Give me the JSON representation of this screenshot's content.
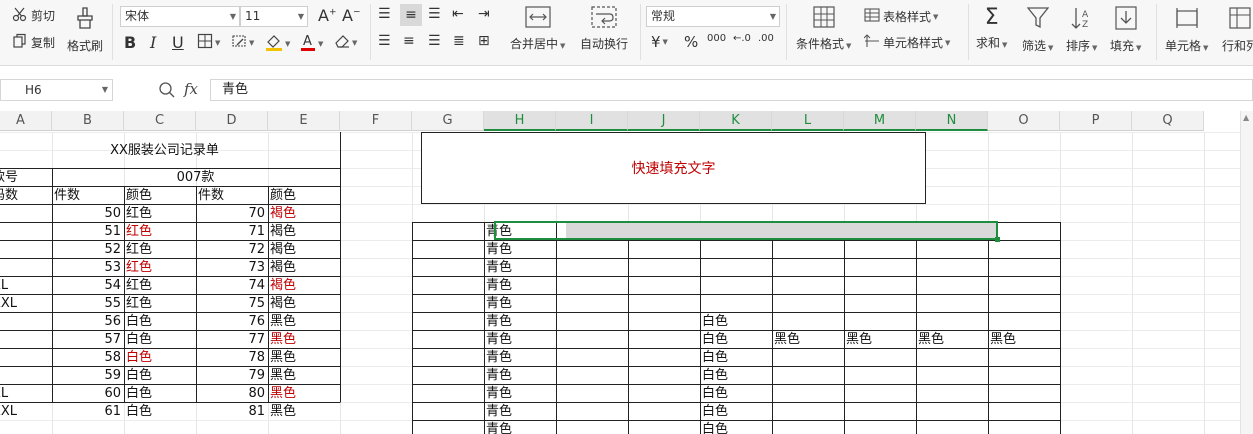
{
  "ribbon": {
    "cut": "剪切",
    "copy": "复制",
    "format_painter": "格式刷",
    "font_name": "宋体",
    "font_size": "11",
    "merge_center": "合并居中",
    "wrap_text": "自动换行",
    "number_format": "常规",
    "conditional_format": "条件格式",
    "table_style": "表格样式",
    "cell_style": "单元格样式",
    "sum": "求和",
    "filter": "筛选",
    "sort": "排序",
    "fill": "填充",
    "cell": "单元格",
    "row_col": "行和列",
    "currency_symbol": "¥",
    "percent_symbol": "%",
    "thousands_symbol": "000"
  },
  "formula_bar": {
    "name_box": "H6",
    "fx": "fx",
    "content": "青色"
  },
  "columns": [
    "A",
    "B",
    "C",
    "D",
    "E",
    "F",
    "G",
    "H",
    "I",
    "J",
    "K",
    "L",
    "M",
    "N",
    "O",
    "P",
    "Q"
  ],
  "selected_column_range": [
    "H",
    "I",
    "J",
    "K",
    "L",
    "M",
    "N"
  ],
  "table1": {
    "title": "XX服装公司记录单",
    "style_label": "款号",
    "style_value": "007款",
    "headers": [
      "码数",
      "件数",
      "颜色",
      "件数",
      "颜色"
    ],
    "rows": [
      {
        "size": "",
        "q1": "50",
        "c1": "红色",
        "q2": "70",
        "c2": "褐色",
        "c1_red": false,
        "c2_red": true
      },
      {
        "size": "",
        "q1": "51",
        "c1": "红色",
        "q2": "71",
        "c2": "褐色",
        "c1_red": true,
        "c2_red": false
      },
      {
        "size": "",
        "q1": "52",
        "c1": "红色",
        "q2": "72",
        "c2": "褐色",
        "c1_red": false,
        "c2_red": false
      },
      {
        "size": "L",
        "q1": "53",
        "c1": "红色",
        "q2": "73",
        "c2": "褐色",
        "c1_red": true,
        "c2_red": false
      },
      {
        "size": "XL",
        "q1": "54",
        "c1": "红色",
        "q2": "74",
        "c2": "褐色",
        "c1_red": false,
        "c2_red": true
      },
      {
        "size": "XXL",
        "q1": "55",
        "c1": "红色",
        "q2": "75",
        "c2": "褐色",
        "c1_red": false,
        "c2_red": false
      },
      {
        "size": "",
        "q1": "56",
        "c1": "白色",
        "q2": "76",
        "c2": "黑色",
        "c1_red": false,
        "c2_red": false
      },
      {
        "size": "",
        "q1": "57",
        "c1": "白色",
        "q2": "77",
        "c2": "黑色",
        "c1_red": false,
        "c2_red": true
      },
      {
        "size": "",
        "q1": "58",
        "c1": "白色",
        "q2": "78",
        "c2": "黑色",
        "c1_red": true,
        "c2_red": false
      },
      {
        "size": "L",
        "q1": "59",
        "c1": "白色",
        "q2": "79",
        "c2": "黑色",
        "c1_red": false,
        "c2_red": false
      },
      {
        "size": "XL",
        "q1": "60",
        "c1": "白色",
        "q2": "80",
        "c2": "黑色",
        "c1_red": false,
        "c2_red": true
      },
      {
        "size": "XXL",
        "q1": "61",
        "c1": "白色",
        "q2": "81",
        "c2": "黑色",
        "c1_red": false,
        "c2_red": false
      }
    ]
  },
  "quick_fill_box": {
    "text": "快速填充文字",
    "color": "#c00000"
  },
  "right_grid": {
    "h_column": [
      "青色",
      "青色",
      "青色",
      "青色",
      "青色",
      "青色",
      "青色",
      "青色",
      "青色",
      "青色",
      "青色",
      "青色"
    ],
    "k_column": [
      "",
      "",
      "",
      "",
      "",
      "白色",
      "白色",
      "白色",
      "白色",
      "白色",
      "白色",
      "白色"
    ],
    "row7": {
      "L": "黑色",
      "M": "黑色",
      "N": "黑色",
      "O": "黑色"
    }
  },
  "colors": {
    "accent_green": "#1e8e3e",
    "red_text": "#c00000",
    "selection_fill": "#d9d9d9"
  }
}
